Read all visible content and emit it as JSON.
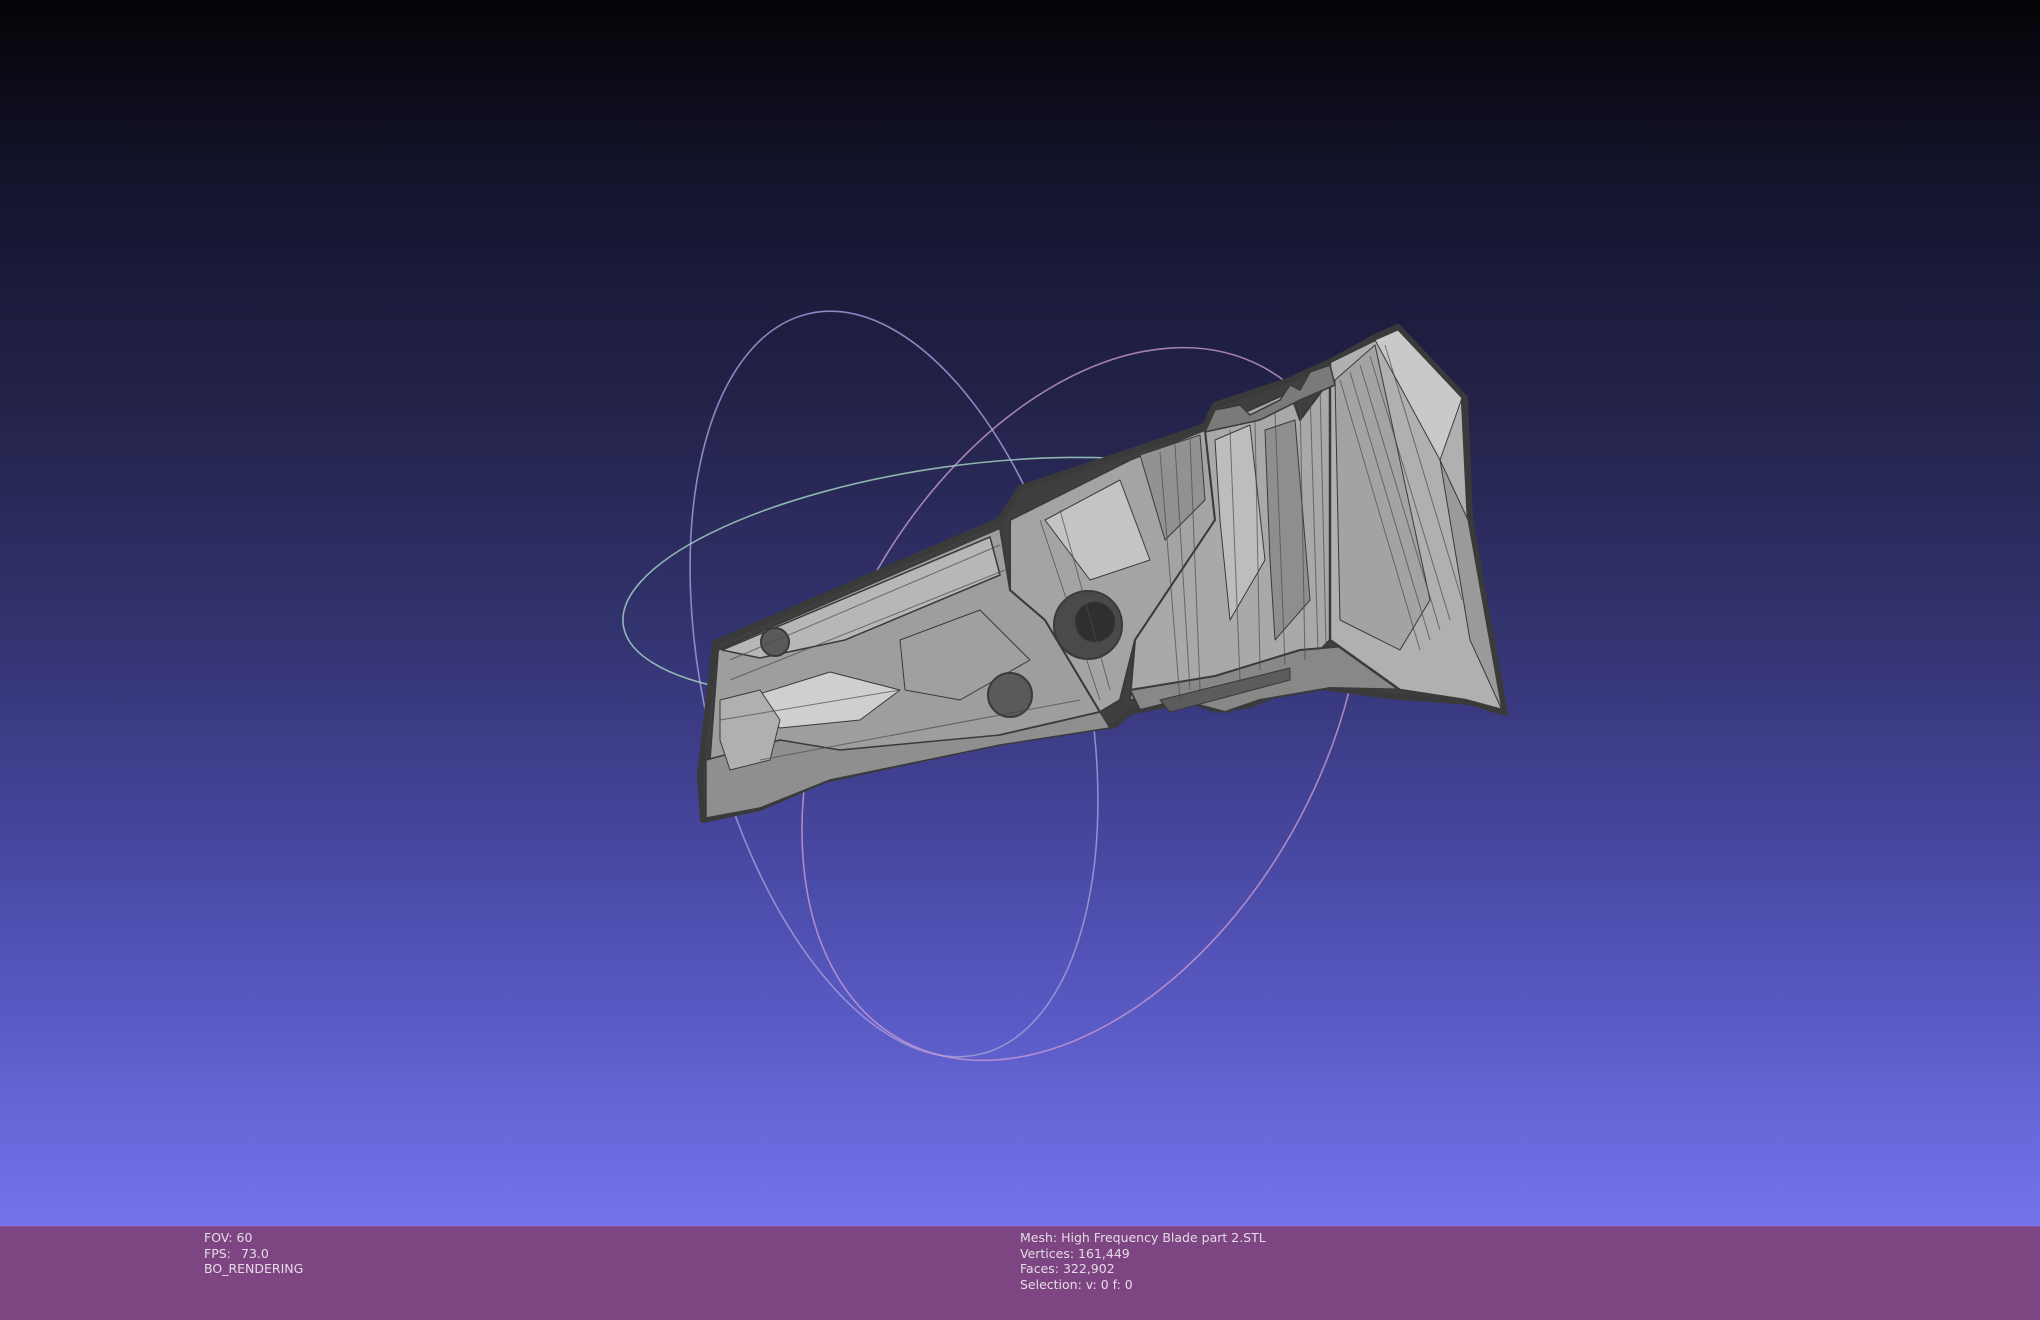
{
  "viewer": {
    "background_top": "#040407",
    "background_bottom": "#7575ea",
    "info_bar_color": "#7d4581",
    "mesh_color": "#a8a8a8",
    "mesh_edge_color": "#3c3c3c"
  },
  "status_left": {
    "fov_label": "FOV:",
    "fov_value": "60",
    "fps_label": "FPS:",
    "fps_value": "73.0",
    "render_mode": "BO_RENDERING"
  },
  "status_right": {
    "mesh_line": "Mesh: High Frequency Blade part 2.STL",
    "vertices_line": "Vertices: 161,449",
    "faces_line": "Faces: 322,902",
    "selection_line": "Selection: v: 0 f: 0"
  }
}
